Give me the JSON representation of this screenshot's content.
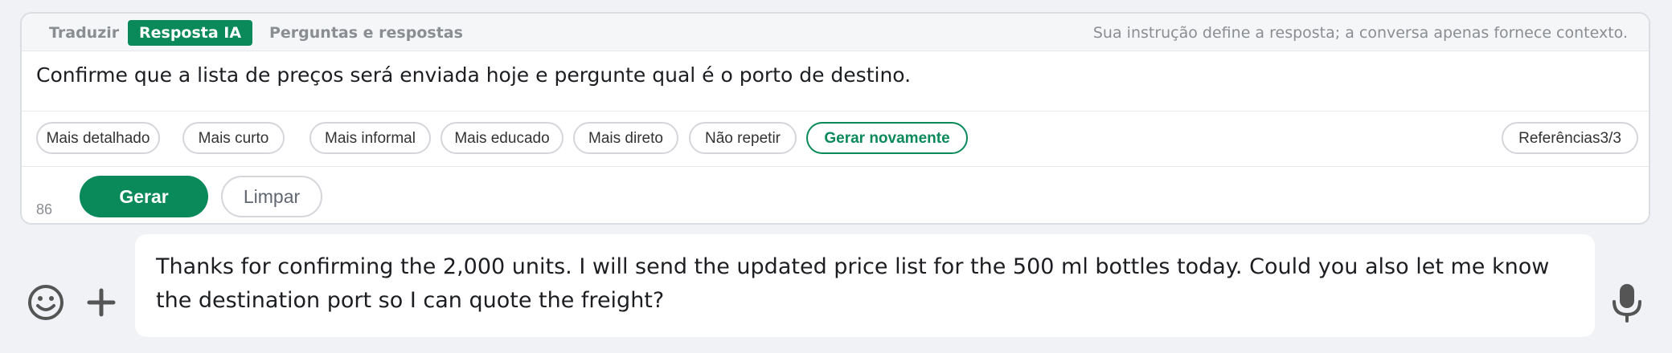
{
  "tabs": [
    {
      "label": "Traduzir",
      "active": false
    },
    {
      "label": "Resposta IA",
      "active": true
    },
    {
      "label": "Perguntas e respostas",
      "active": false
    }
  ],
  "hint_text": "Sua instrução define a resposta; a conversa apenas fornece contexto.",
  "instruction_text": "Confirme que a lista de preços será enviada hoje e pergunte qual é o porto de destino.",
  "chips": [
    {
      "label": "Mais detalhado"
    },
    {
      "label": "Mais curto"
    },
    {
      "label": "Mais informal"
    },
    {
      "label": "Mais educado"
    },
    {
      "label": "Mais direto"
    },
    {
      "label": "Não repetir"
    },
    {
      "label": "Gerar novamente",
      "active": true
    }
  ],
  "references_label": "Referências3/3",
  "char_count": "86",
  "generate_label": "Gerar",
  "clear_label": "Limpar",
  "message_text": "Thanks for confirming the 2,000 units. I will send the updated price list for the 500 ml bottles today. Could you also let me know the destination port so I can quote the freight?",
  "icons": {
    "emoji": "smiley-icon",
    "plus": "plus-icon",
    "mic": "microphone-icon"
  },
  "colors": {
    "accent": "#0a8a5b",
    "background": "#f0f2f5",
    "icon": "#555555"
  }
}
